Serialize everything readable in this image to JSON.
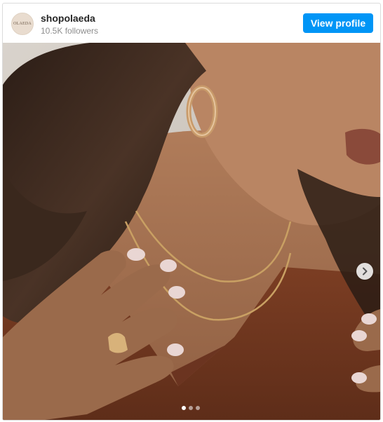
{
  "header": {
    "avatar_text": "OLAEDA",
    "username": "shopolaeda",
    "followers": "10.5K followers",
    "view_profile_label": "View profile"
  },
  "post": {
    "image_description_icon": "photo",
    "carousel": {
      "total": 3,
      "current": 1
    },
    "next_icon": "chevron-right-icon"
  },
  "colors": {
    "accent": "#0095f6",
    "text": "#262626",
    "muted": "#8e8e8e"
  }
}
